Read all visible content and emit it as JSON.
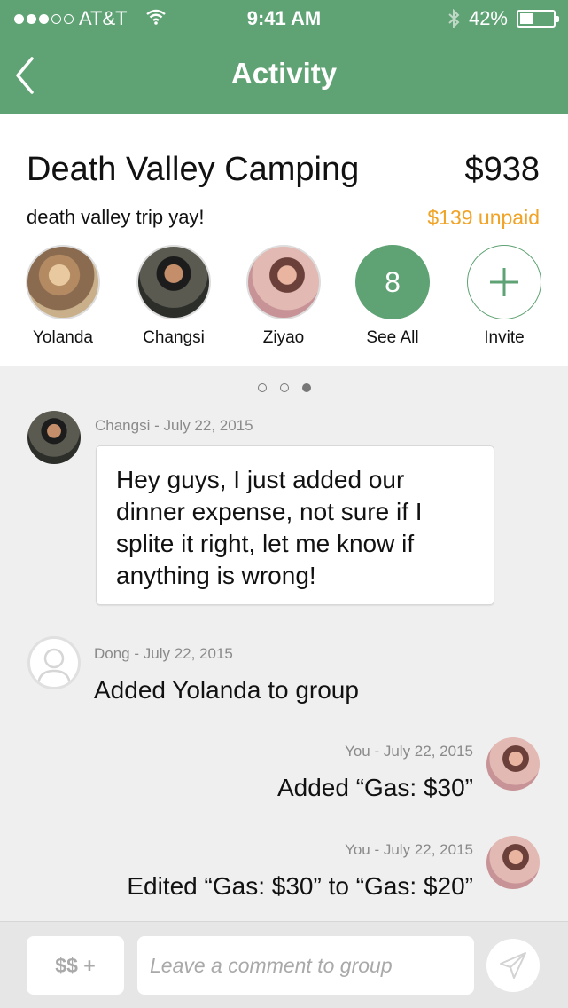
{
  "status_bar": {
    "carrier": "AT&T",
    "time": "9:41 AM",
    "battery": "42%",
    "battery_level": 0.42
  },
  "nav": {
    "title": "Activity"
  },
  "group": {
    "title": "Death Valley Camping",
    "total": "$938",
    "description": "death valley trip yay!",
    "unpaid": "$139 unpaid"
  },
  "members": [
    {
      "name": "Yolanda"
    },
    {
      "name": "Changsi"
    },
    {
      "name": "Ziyao"
    }
  ],
  "see_all": {
    "count": "8",
    "label": "See All"
  },
  "invite": {
    "label": "Invite"
  },
  "pager": {
    "pages": 3,
    "active": 2
  },
  "feed": [
    {
      "author_meta": "Changsi - July 22, 2015",
      "text": "Hey guys, I just added our dinner expense, not sure if I splite it right, let me know if anything is wrong!"
    },
    {
      "author_meta": "Dong - July 22, 2015",
      "text": "Added Yolanda to group"
    },
    {
      "author_meta": "You - July 22, 2015",
      "text": "Added “Gas: $30”"
    },
    {
      "author_meta": "You - July 22, 2015",
      "text": "Edited “Gas: $30” to “Gas: $20”"
    }
  ],
  "composer": {
    "money_button": "$$ +",
    "placeholder": "Leave a comment to group"
  },
  "colors": {
    "brand_green": "#5fa274",
    "unpaid_orange": "#f0a326",
    "meta_gray": "#8a8a8a"
  }
}
